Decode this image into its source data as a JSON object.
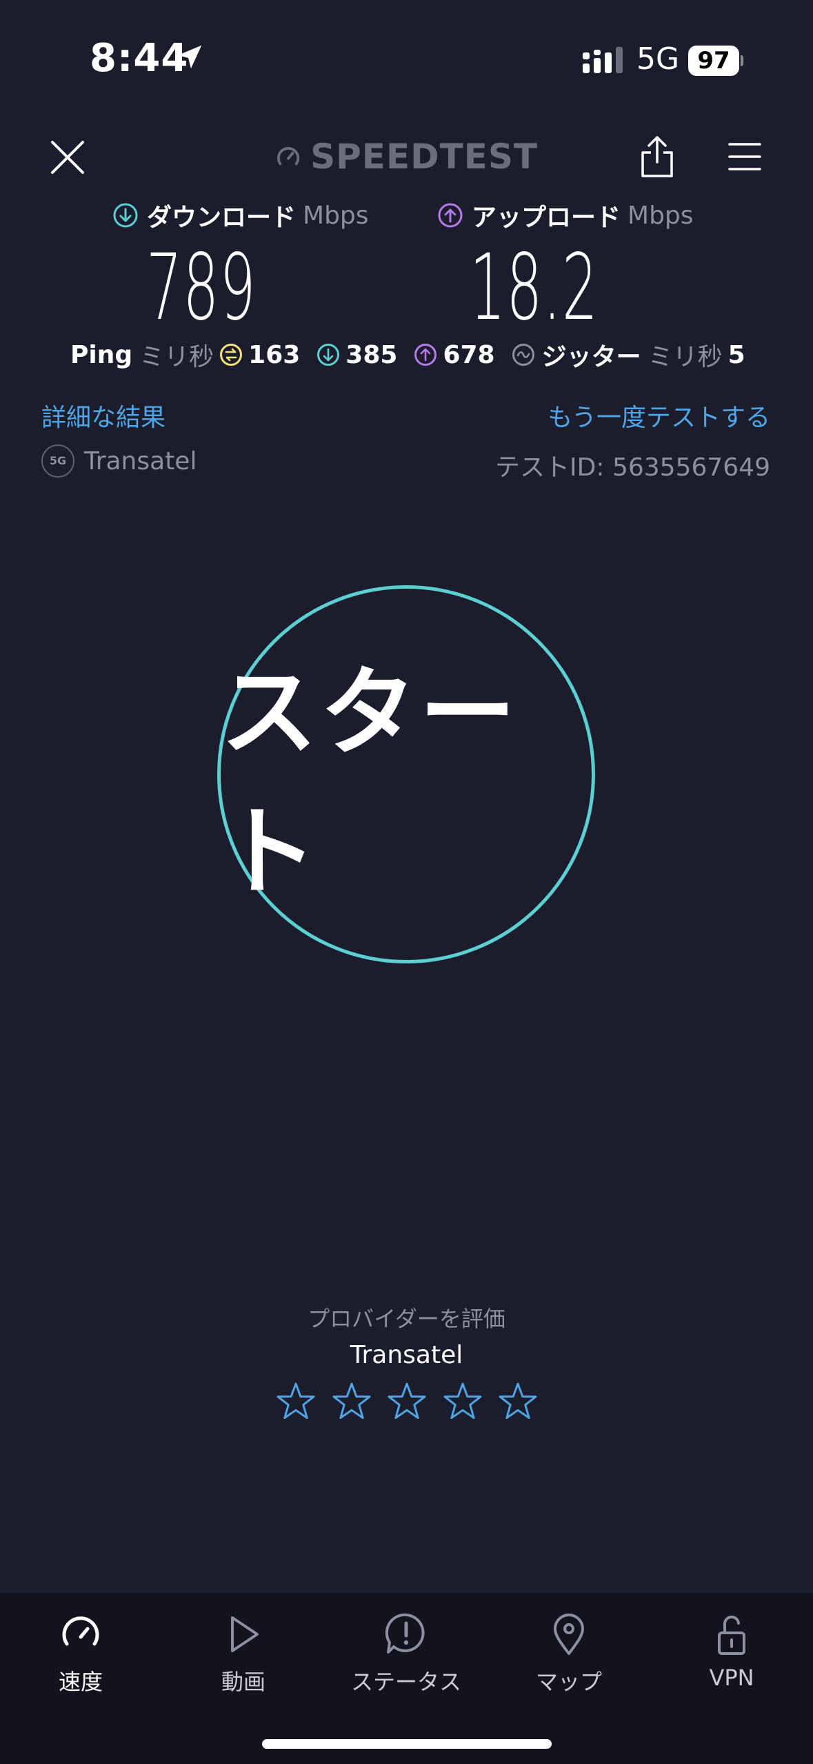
{
  "status_bar": {
    "time": "8:44",
    "network": "5G",
    "battery": "97"
  },
  "header": {
    "logo_text": "SPEEDTEST",
    "logo_mark": "®"
  },
  "download": {
    "label": "ダウンロード",
    "unit": "Mbps",
    "value": "789",
    "icon": "download-circle-icon",
    "color": "#5ccfd3"
  },
  "upload": {
    "label": "アップロード",
    "unit": "Mbps",
    "value": "18.2",
    "icon": "upload-circle-icon",
    "color": "#b57be8"
  },
  "ping": {
    "label": "Ping",
    "unit": "ミリ秒",
    "idle": "163",
    "download": "385",
    "upload": "678",
    "jitter_label": "ジッター",
    "jitter_unit": "ミリ秒",
    "jitter": "5",
    "idle_color": "#f5e27a"
  },
  "links": {
    "details": "詳細な結果",
    "retest": "もう一度テストする"
  },
  "provider": {
    "badge": "5G",
    "name": "Transatel",
    "test_id": "テストID: 5635567649"
  },
  "start_button": {
    "label": "スタート",
    "ring_color": "#5ccfd3"
  },
  "rating": {
    "title": "プロバイダーを評価",
    "provider": "Transatel",
    "stars_total": 5,
    "stars_selected": 0
  },
  "tabs": [
    {
      "label": "速度",
      "icon": "speedometer-icon",
      "active": true
    },
    {
      "label": "動画",
      "icon": "play-icon",
      "active": false
    },
    {
      "label": "ステータス",
      "icon": "alert-bubble-icon",
      "active": false
    },
    {
      "label": "マップ",
      "icon": "map-pin-icon",
      "active": false
    },
    {
      "label": "VPN",
      "icon": "unlock-icon",
      "active": false
    }
  ]
}
